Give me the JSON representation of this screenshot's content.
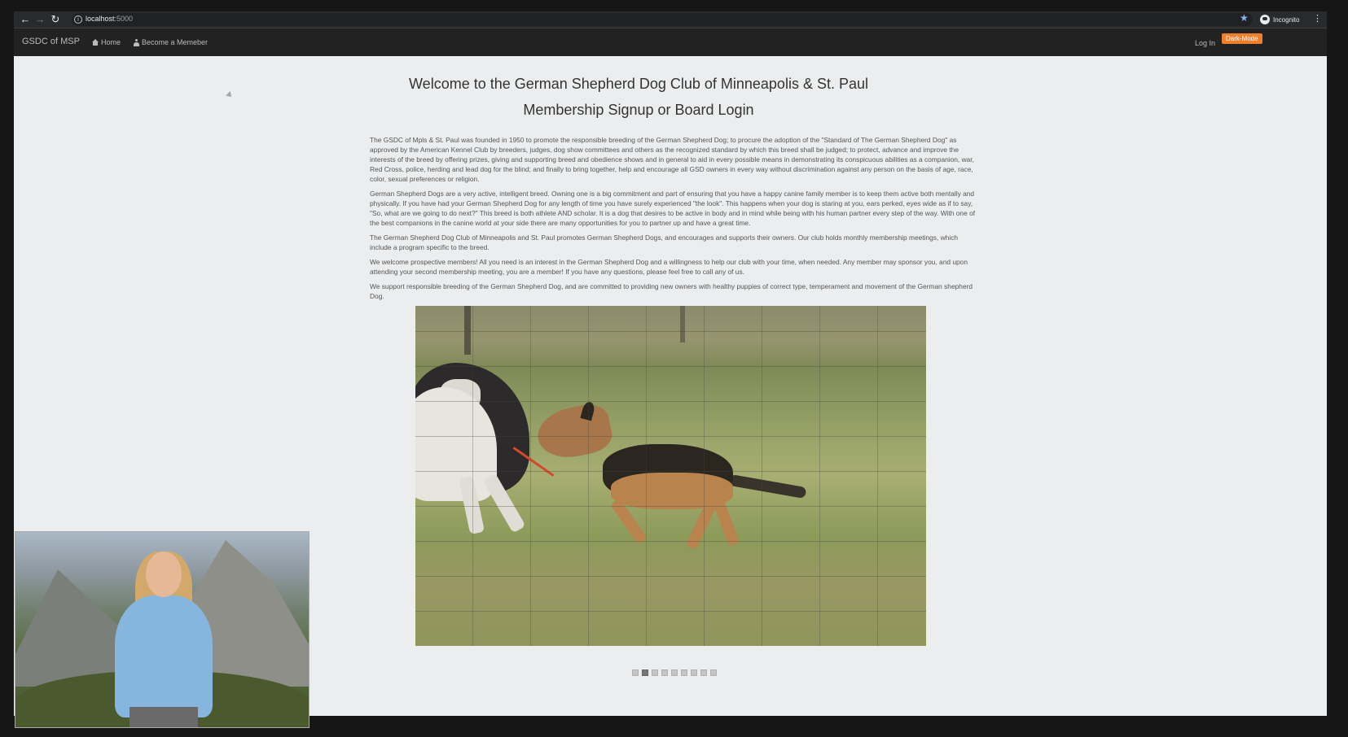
{
  "browser": {
    "url_host": "localhost",
    "url_port": ":5000",
    "profile_label": "Incognito"
  },
  "navbar": {
    "brand": "GSDC of MSP",
    "links": [
      {
        "label": "Home",
        "icon": "home-icon"
      },
      {
        "label": "Become a Memeber",
        "icon": "user-icon"
      }
    ],
    "login": "Log In",
    "dark_mode": "Dark-Mode"
  },
  "main": {
    "title": "Welcome to the German Shepherd Dog Club of Minneapolis & St. Paul",
    "subtitle": "Membership Signup or Board Login",
    "paragraphs": [
      "The GSDC of Mpls & St. Paul was founded in 1950 to promote the responsible breeding of the German Shepherd Dog; to procure the adoption of the \"Standard of The German Shepherd Dog\" as approved by the American Kennel Club by breeders, judges, dog show committees and others as the recognized standard by which this breed shall be judged; to protect, advance and improve the interests of the breed by offering prizes, giving and supporting breed and obedience shows and in general to aid in every possible means in demonstrating its conspicuous abilities as a companion, war, Red Cross, police, herding and lead dog for the blind; and finally to bring together, help and encourage all GSD owners in every way without discrimination against any person on the basis of age, race, color, sexual preferences or religion.",
      "German Shepherd Dogs are a very active, intelligent breed. Owning one is a big commitment and part of ensuring that you have a happy canine family member is to keep them active both mentally and physically. If you have had your German Shepherd Dog for any length of time you have surely experienced \"the look\". This happens when your dog is staring at you, ears perked, eyes wide as if to say, \"So, what are we going to do next?\" This breed is both athlete AND scholar. It is a dog that desires to be active in body and in mind while being with his human partner every step of the way. With one of the best companions in the canine world at your side there are many opportunities for you to partner up and have a great time.",
      "The German Shepherd Dog Club of Minneapolis and St. Paul promotes German Shepherd Dogs, and encourages and supports their owners. Our club holds monthly membership meetings, which include a program specific to the breed.",
      "We welcome prospective members! All you need is an interest in the German Shepherd Dog and a willingness to help our club with your time, when needed. Any member may sponsor you, and upon attending your second membership meeting, you are a member! If you have any questions, please feel free to call any of us.",
      "We support responsible breeding of the German Shepherd Dog, and are committed to providing new owners with healthy puppies of correct type, temperament and movement of the German shepherd Dog."
    ]
  },
  "carousel": {
    "slide_count": 9,
    "active_index": 1
  },
  "colors": {
    "accent": "#ee7f2d",
    "navbar_bg": "#222222",
    "page_bg": "#ecedee"
  }
}
